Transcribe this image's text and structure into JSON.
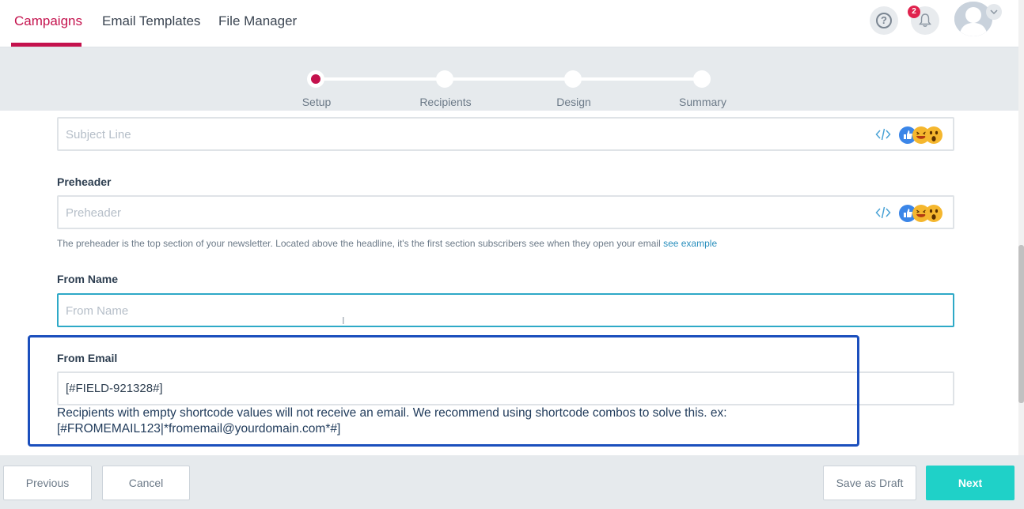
{
  "nav": {
    "tabs": [
      {
        "label": "Campaigns",
        "active": true
      },
      {
        "label": "Email Templates",
        "active": false
      },
      {
        "label": "File Manager",
        "active": false
      }
    ],
    "notification_count": "2",
    "help_icon": "question-circle-icon",
    "bell_icon": "bell-icon"
  },
  "stepper": {
    "steps": [
      {
        "label": "Setup",
        "active": true
      },
      {
        "label": "Recipients",
        "active": false
      },
      {
        "label": "Design",
        "active": false
      },
      {
        "label": "Summary",
        "active": false
      }
    ]
  },
  "form": {
    "subject": {
      "placeholder": "Subject Line"
    },
    "preheader": {
      "label": "Preheader",
      "placeholder": "Preheader",
      "hint": "The preheader is the top section of your newsletter. Located above the headline, it's the first section subscribers see when they open your email ",
      "hint_link": "see example"
    },
    "from_name": {
      "label": "From Name",
      "placeholder": "From Name"
    },
    "from_email": {
      "label": "From Email",
      "value": "[#FIELD-921328#]",
      "warning_line1": "Recipients with empty shortcode values will not receive an email. We recommend using shortcode combos to solve this. ex:",
      "warning_line2": "[#FROMEMAIL123|*fromemail@yourdomain.com*#]"
    }
  },
  "footer": {
    "previous": "Previous",
    "cancel": "Cancel",
    "save_draft": "Save as Draft",
    "next": "Next"
  },
  "colors": {
    "brand": "#c4124d",
    "primary_button": "#1fd1c8",
    "focus_border": "#2ea9c7",
    "highlight_box": "#1b4fbd"
  }
}
